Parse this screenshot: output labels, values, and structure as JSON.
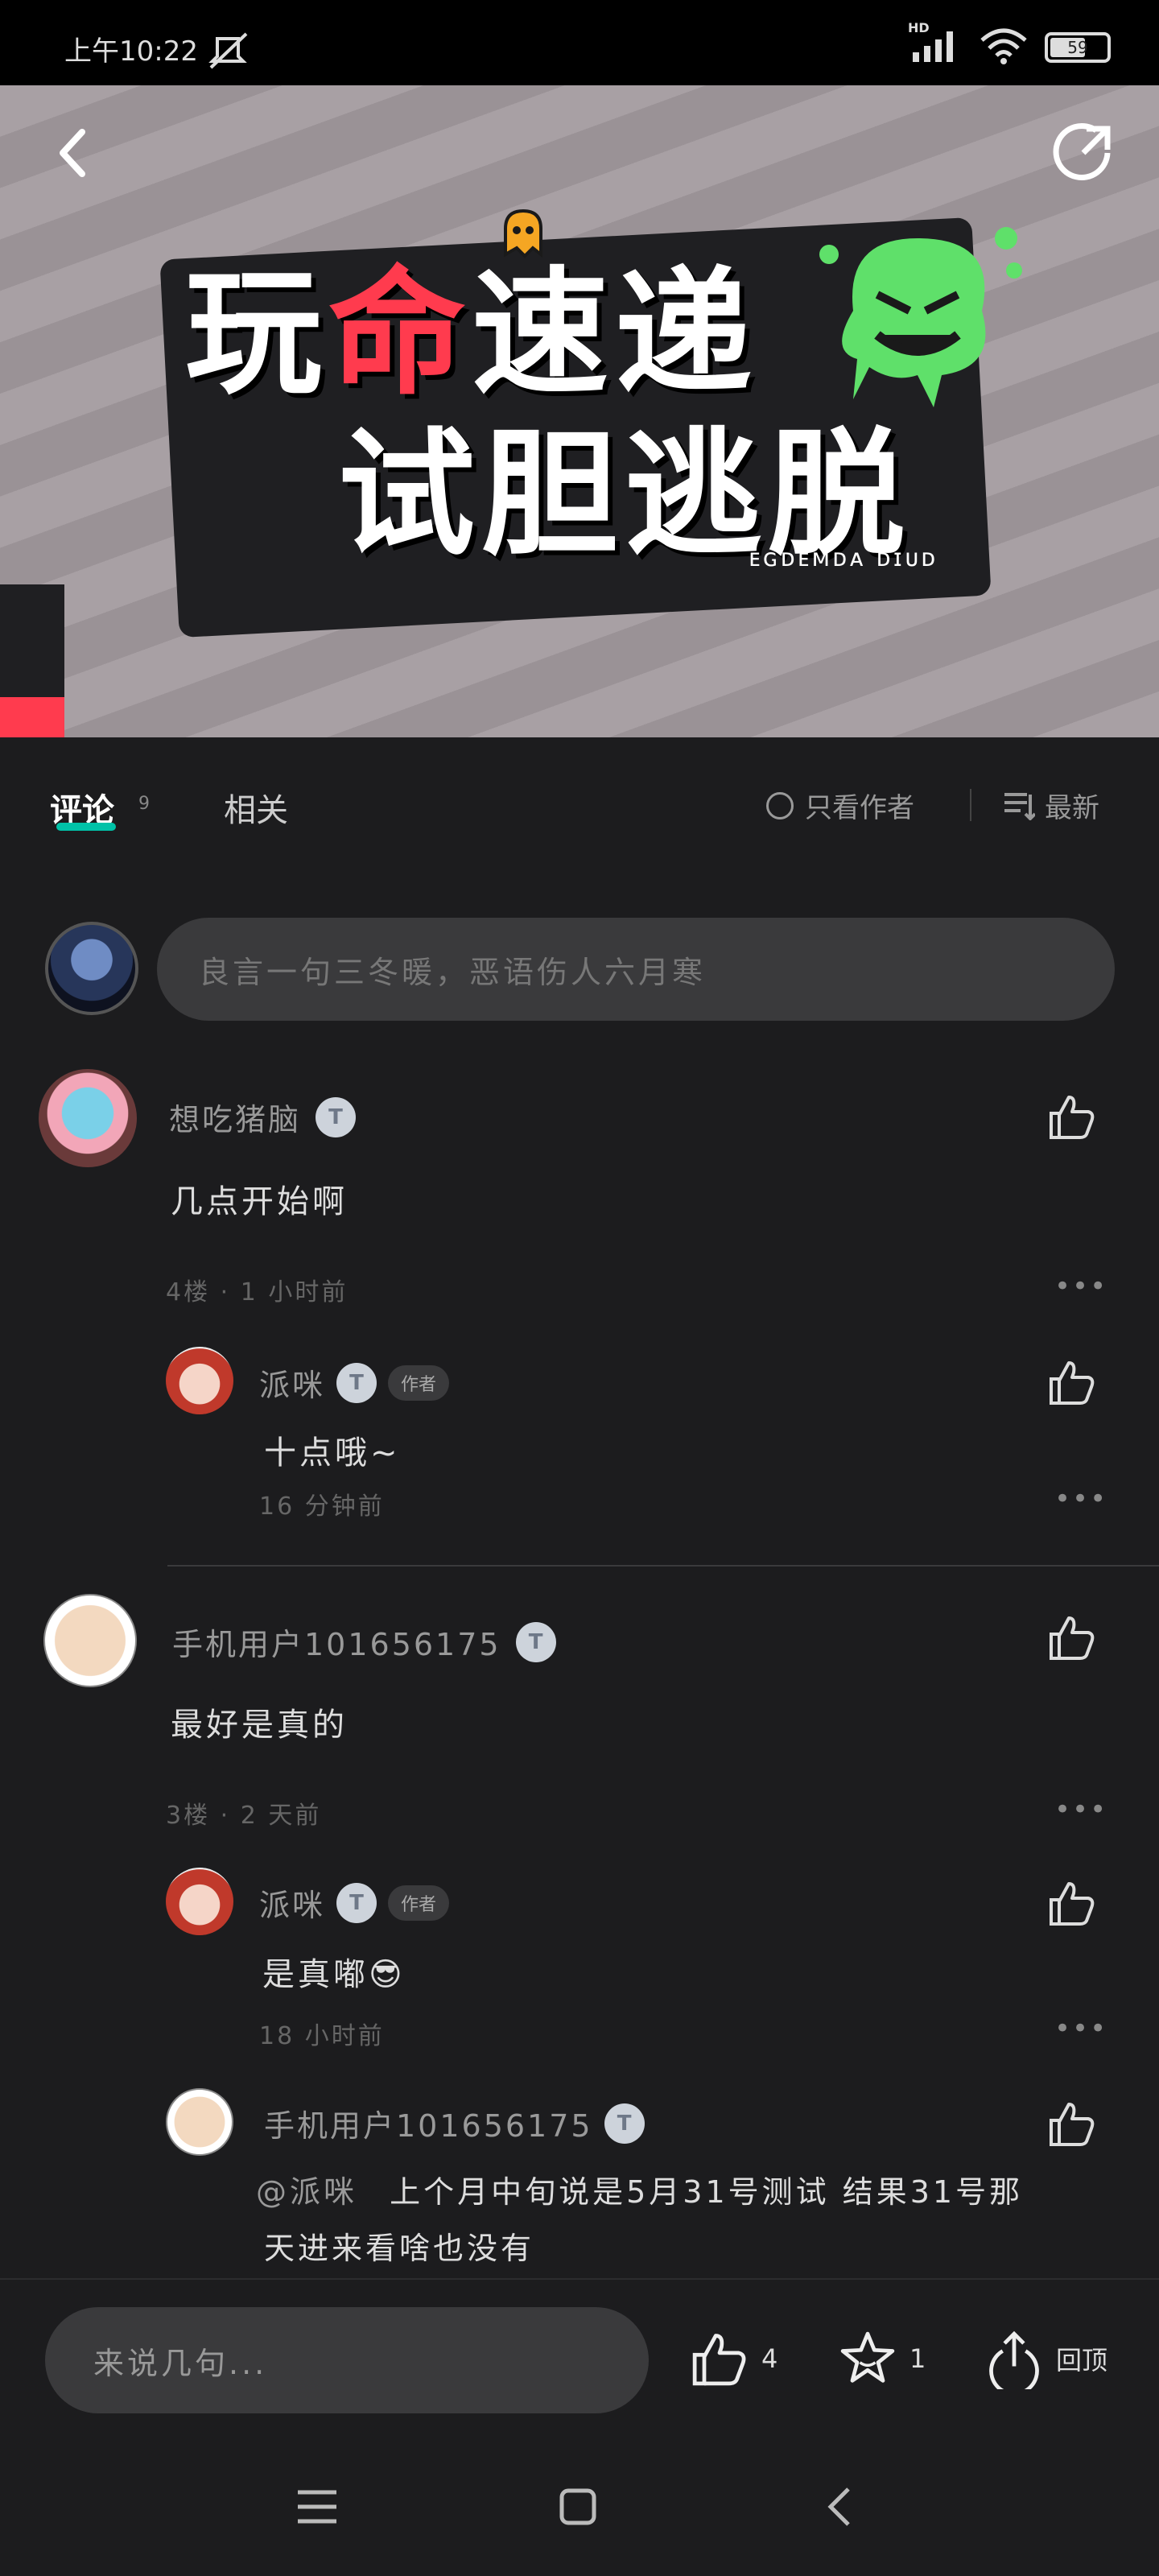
{
  "status_bar": {
    "time": "上午10:22",
    "network": "HD",
    "battery": "59"
  },
  "banner": {
    "title_line1_a": "玩",
    "title_line1_b": "命",
    "title_line1_c": "速递",
    "title_line2": "试胆逃脱",
    "subtitle": "ᴇɢᴅᴇᴍᴅᴀ ᴅɪᴜᴅ"
  },
  "tabs": {
    "comments_label": "评论",
    "comments_count": "9",
    "related_label": "相关",
    "only_author_label": "只看作者",
    "sort_label": "最新"
  },
  "comment_input": {
    "placeholder": "良言一句三冬暖，恶语伤人六月寒"
  },
  "comments": [
    {
      "username": "想吃猪脑",
      "level": "T",
      "text": "几点开始啊",
      "meta": "4楼 · 1 小时前",
      "replies": [
        {
          "username": "派咪",
          "level": "T",
          "author_tag": "作者",
          "text": "十点哦~",
          "meta": "16 分钟前"
        }
      ]
    },
    {
      "username": "手机用户101656175",
      "level": "T",
      "text": "最好是真的",
      "meta": "3楼 · 2 天前",
      "replies": [
        {
          "username": "派咪",
          "level": "T",
          "author_tag": "作者",
          "text": "是真嘟😎",
          "meta": "18 小时前"
        },
        {
          "username": "手机用户101656175",
          "level": "T",
          "text_mention": "@派咪",
          "text_line1": "上个月中旬说是5月31号测试 结果31号那",
          "text_line2": "天进来看啥也没有"
        }
      ]
    }
  ],
  "bottom_bar": {
    "input_placeholder": "来说几句...",
    "like_count": "4",
    "favorite_count": "1",
    "top_label": "回顶"
  },
  "colors": {
    "accent": "#00c2a8",
    "background": "#1c1c1e"
  }
}
